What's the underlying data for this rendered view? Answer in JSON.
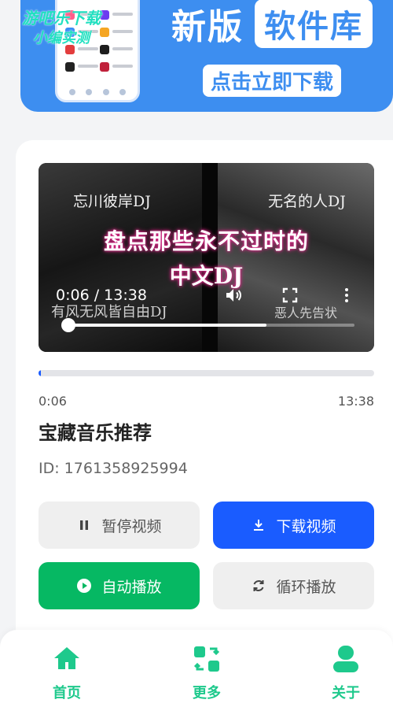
{
  "banner": {
    "title_left": "新版",
    "title_right": "软件库",
    "cta": "点击立即下载",
    "watermark_line1": "游吧乐下载",
    "watermark_line2": "小编实测"
  },
  "video": {
    "subtitle_top_left": "忘川彼岸DJ",
    "subtitle_top_right": "无名的人DJ",
    "caption_line1": "盘点那些永不过时的",
    "caption_line2": "中文DJ",
    "subtitle_bottom_left": "有风无风皆自由DJ",
    "subtitle_bottom_right": "恶人先告状",
    "time_display": "0:06 / 13:38",
    "playback_fraction": 0.0073
  },
  "player": {
    "current_time": "0:06",
    "duration": "13:38",
    "progress_fraction": 0.0073,
    "title": "宝藏音乐推荐",
    "id_label": "ID: 1761358925994"
  },
  "buttons": {
    "pause": "暂停视频",
    "download": "下载视频",
    "autoplay": "自动播放",
    "loop": "循环播放"
  },
  "nav": {
    "home": "首页",
    "more": "更多",
    "about": "关于"
  },
  "colors": {
    "primary_blue": "#1a5cff",
    "green": "#06b863",
    "nav_green": "#1ec98c",
    "banner_blue": "#3d8ef0"
  },
  "icons": {
    "pause": "pause-icon",
    "download": "download-icon",
    "autoplay": "play-circle-icon",
    "loop": "loop-icon",
    "home": "home-icon",
    "more": "swap-grid-icon",
    "about": "user-icon"
  }
}
